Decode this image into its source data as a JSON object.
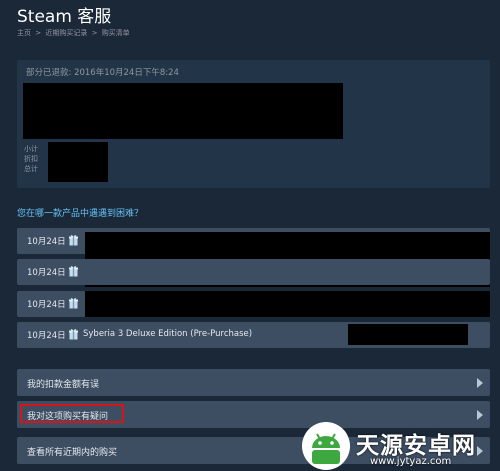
{
  "header": {
    "title": "Steam 客服",
    "breadcrumb": [
      "主页",
      "近期购买记录",
      "购买清单"
    ],
    "separator": ">"
  },
  "purchase": {
    "refund_status": "部分已退款: 2016年10月24日下午8:24",
    "totals_labels": [
      "小计",
      "折扣",
      "总计"
    ]
  },
  "section": {
    "heading": "您在哪一款产品中遇遇到困难？"
  },
  "purchase_rows": [
    {
      "date": "10月24日",
      "name": ""
    },
    {
      "date": "10月24日",
      "name": ""
    },
    {
      "date": "10月24日",
      "name": ""
    },
    {
      "date": "10月24日",
      "name": "Syberia 3 Deluxe Edition (Pre-Purchase)"
    }
  ],
  "menu": [
    {
      "label": "我的扣款金额有误"
    },
    {
      "label": "我对这项购买有疑问"
    },
    {
      "label": "查看所有近期内的购买"
    }
  ],
  "watermark": {
    "name": "天源安卓网",
    "url": "www.jytyaz.com"
  },
  "colors": {
    "background": "#1b2838",
    "row": "#3d4e63",
    "link": "#66c0f4",
    "highlight": "#d5151a"
  }
}
